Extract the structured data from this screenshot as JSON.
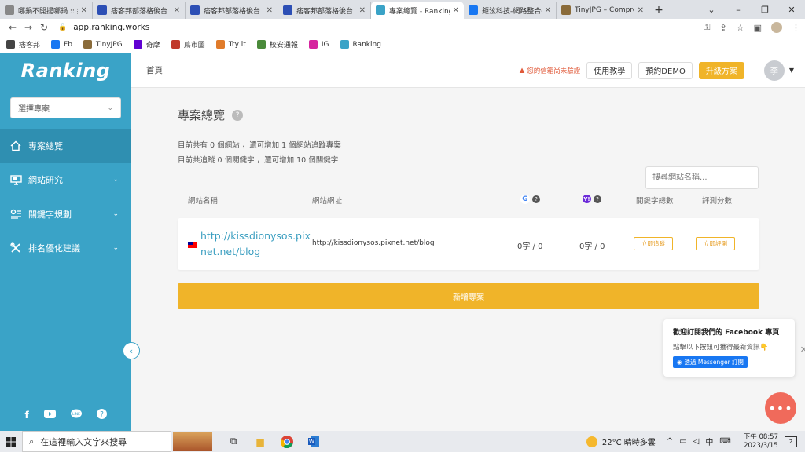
{
  "browser": {
    "tabs": [
      {
        "title": "哪鍋不開提哪鍋 :: 痞客",
        "icon": "pixnet-favicon-icon",
        "color": "#888888",
        "active": false
      },
      {
        "title": "痞客邦部落格後台",
        "icon": "pixnet-favicon-icon",
        "color": "#2d4fb5",
        "active": false
      },
      {
        "title": "痞客邦部落格後台",
        "icon": "pixnet-favicon-icon",
        "color": "#2d4fb5",
        "active": false
      },
      {
        "title": "痞客邦部落格後台",
        "icon": "pixnet-favicon-icon",
        "color": "#2d4fb5",
        "active": false
      },
      {
        "title": "專案總覽 - Ranking",
        "icon": "ranking-favicon-icon",
        "color": "#3aa3c7",
        "active": true
      },
      {
        "title": "鉅泫科技-網路整合行",
        "icon": "facebook-favicon-icon",
        "color": "#1877f2",
        "active": false
      },
      {
        "title": "TinyJPG – Compress",
        "icon": "tinyjpg-favicon-icon",
        "color": "#8a6b3a",
        "active": false
      }
    ],
    "url": "app.ranking.works",
    "bookmarks": [
      {
        "label": "痞客邦",
        "color": "#444444"
      },
      {
        "label": "Fb",
        "color": "#1877f2"
      },
      {
        "label": "TinyJPG",
        "color": "#8a6b3a"
      },
      {
        "label": "奇摩",
        "color": "#6001d2"
      },
      {
        "label": "蔦市圖",
        "color": "#c0392b"
      },
      {
        "label": "Try it",
        "color": "#e07b2a"
      },
      {
        "label": "校安通報",
        "color": "#4a8a3a"
      },
      {
        "label": "IG",
        "color": "#d6249f"
      },
      {
        "label": "Ranking",
        "color": "#3aa3c7"
      }
    ]
  },
  "sidebar": {
    "logo": "Ranking",
    "project_select": "選擇專案",
    "items": [
      {
        "label": "專案總覽",
        "icon": "home-icon",
        "active": true
      },
      {
        "label": "網站研究",
        "icon": "monitor-icon",
        "active": false
      },
      {
        "label": "關鍵字規劃",
        "icon": "keyword-icon",
        "active": false
      },
      {
        "label": "排名優化建議",
        "icon": "tools-icon",
        "active": false
      }
    ],
    "social": [
      "facebook-icon",
      "youtube-icon",
      "line-icon",
      "help-icon"
    ]
  },
  "topbar": {
    "breadcrumb": "首頁",
    "warning": "您的信箱尚未驗證",
    "tutorial": "使用教學",
    "demo": "預約DEMO",
    "upgrade": "升級方案",
    "user_initial": "李"
  },
  "main": {
    "title": "專案總覽",
    "stat_line1": "目前共有 0 個網站 ，還可增加 1 個網站追蹤專案",
    "stat_line2": "目前共追蹤 0 個關鍵字 ，還可增加 10 個關鍵字",
    "search_placeholder": "搜尋網站名稱...",
    "columns": {
      "name": "網站名稱",
      "url": "網站網址",
      "keywords": "關鍵字總數",
      "score": "評測分數"
    },
    "rows": [
      {
        "name": "http://kissdionysos.pixnet.net/blog",
        "url": "http://kissdionysos.pixnet.net/blog",
        "google": "0字 / 0",
        "yahoo": "0字 / 0",
        "track": "立即追蹤",
        "evaluate": "立即評測"
      }
    ],
    "add_button": "新增專案"
  },
  "facebook_popup": {
    "title": "歡迎訂閱我們的 Facebook 專頁",
    "desc": "點擊以下按鈕可獲得最新資訊👇",
    "button": "透過 Messenger 訂閱"
  },
  "taskbar": {
    "search_placeholder": "在這裡輸入文字來搜尋",
    "weather": "22°C  晴時多雲",
    "ime": "中",
    "time": "下午 08:57",
    "date": "2023/3/15",
    "notifications": "2"
  }
}
